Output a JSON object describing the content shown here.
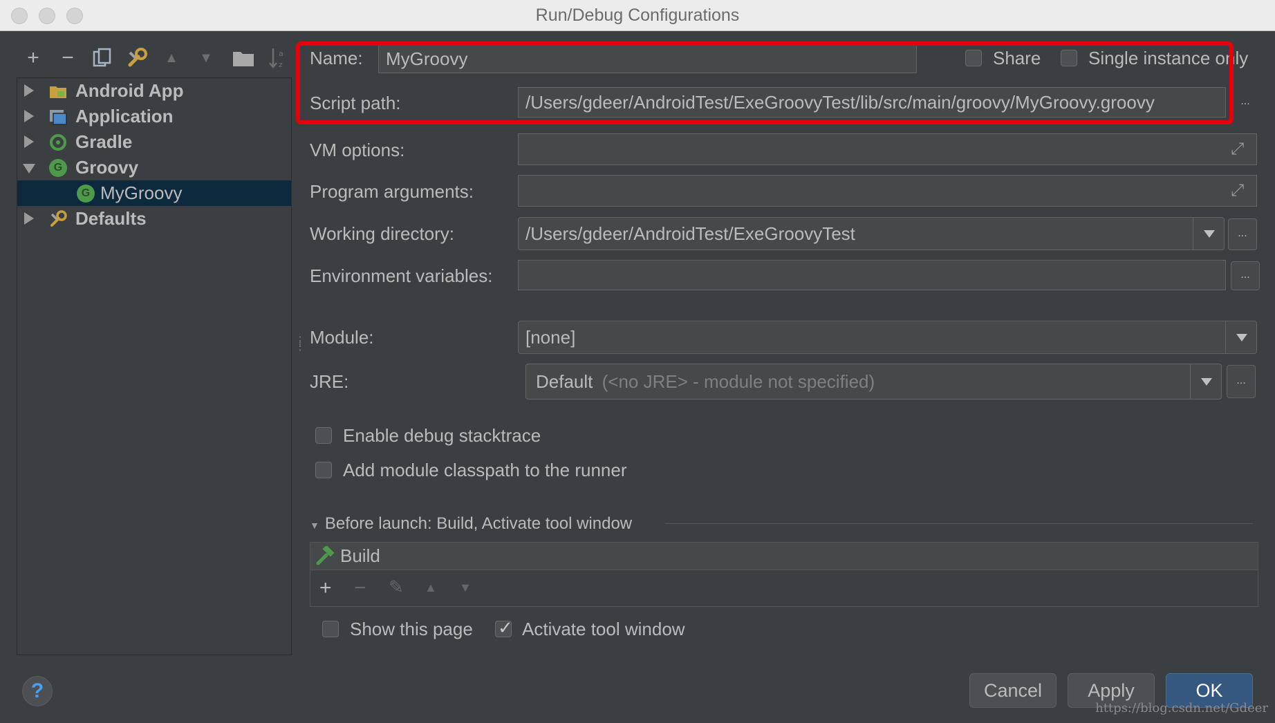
{
  "window": {
    "title": "Run/Debug Configurations"
  },
  "toolbar": {
    "add": "+",
    "remove": "−",
    "copy": "copy-icon",
    "edit_defaults": "wrench-icon",
    "move_up": "▲",
    "move_down": "▼",
    "folder": "folder-icon",
    "sort": "sort-alpha-icon"
  },
  "tree": {
    "items": [
      {
        "label": "Android App",
        "icon": "android-app-icon",
        "expanded": false
      },
      {
        "label": "Application",
        "icon": "application-icon",
        "expanded": false
      },
      {
        "label": "Gradle",
        "icon": "gradle-icon",
        "expanded": false
      },
      {
        "label": "Groovy",
        "icon": "groovy-icon",
        "expanded": true
      },
      {
        "label": "MyGroovy",
        "icon": "groovy-icon",
        "selected": true
      },
      {
        "label": "Defaults",
        "icon": "wrench-icon",
        "expanded": false
      }
    ],
    "groovy_glyph": "G"
  },
  "form": {
    "name_label": "Name:",
    "name_value": "MyGroovy",
    "share_label": "Share",
    "single_instance_label": "Single instance only",
    "script_path_label": "Script path:",
    "script_path_value": "/Users/gdeer/AndroidTest/ExeGroovyTest/lib/src/main/groovy/MyGroovy.groovy",
    "vm_options_label": "VM options:",
    "vm_options_value": "",
    "program_args_label": "Program arguments:",
    "program_args_value": "",
    "working_dir_label": "Working directory:",
    "working_dir_value": "/Users/gdeer/AndroidTest/ExeGroovyTest",
    "env_vars_label": "Environment variables:",
    "env_vars_value": "",
    "module_label": "Module:",
    "module_value": "[none]",
    "jre_label": "JRE:",
    "jre_value": "Default",
    "jre_hint": "(<no JRE> - module not specified)",
    "enable_debug_label": "Enable debug stacktrace",
    "add_classpath_label": "Add module classpath to the runner",
    "ellipsis": "..."
  },
  "before_launch": {
    "header": "Before launch: Build, Activate tool window",
    "items": [
      {
        "label": "Build",
        "icon": "hammer-icon"
      }
    ],
    "tools": {
      "add": "+",
      "remove": "−",
      "edit": "✎",
      "up": "▲",
      "down": "▼"
    }
  },
  "footer": {
    "show_page_label": "Show this page",
    "activate_tool_label": "Activate tool window",
    "activate_tool_checked": true,
    "check_glyph": "✓",
    "help": "?",
    "cancel": "Cancel",
    "apply": "Apply",
    "ok": "OK",
    "watermark": "https://blog.csdn.net/Gdeer"
  },
  "colors": {
    "accent_selection": "#0d293e",
    "highlight_box": "#e8000c",
    "default_button": "#365880"
  }
}
